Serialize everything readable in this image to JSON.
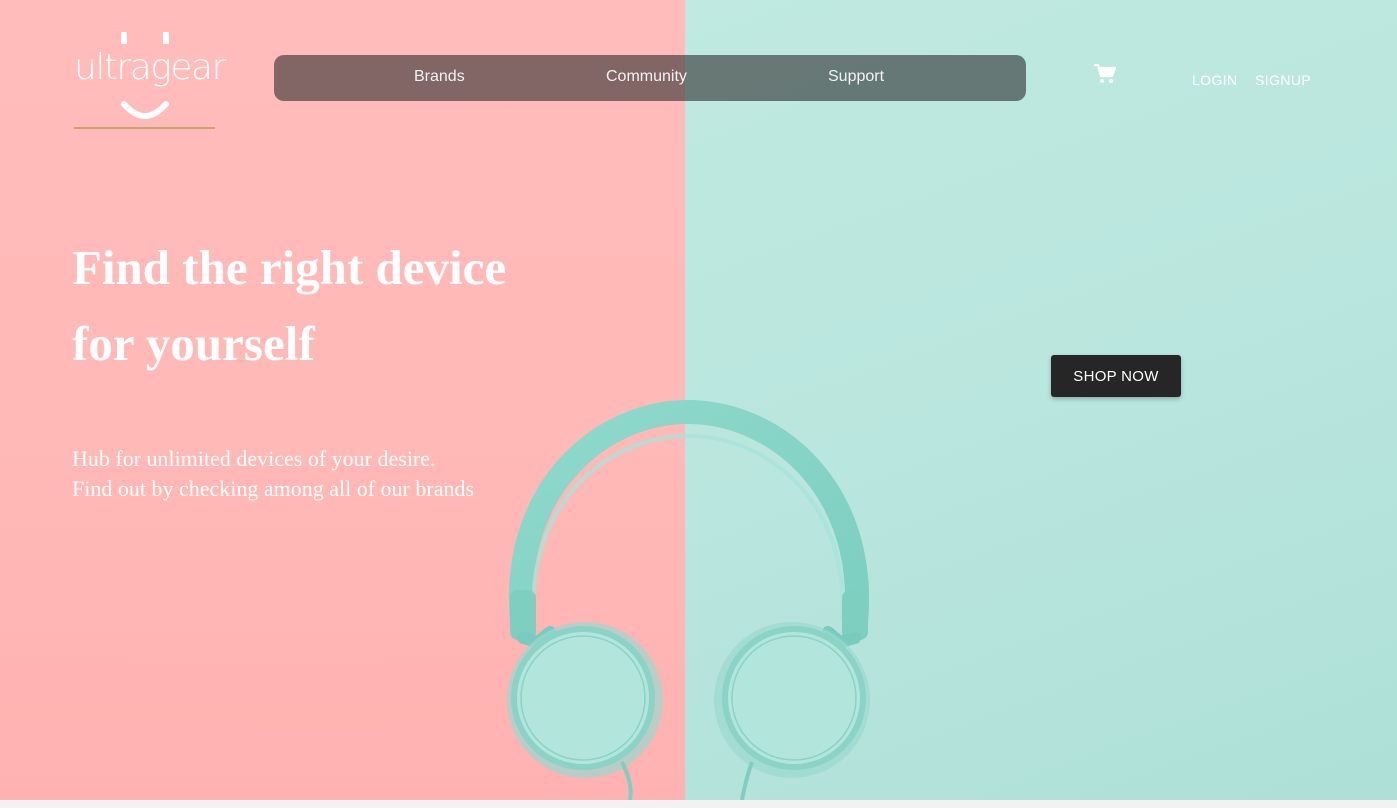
{
  "logo": {
    "text": "ultragear"
  },
  "nav": {
    "links": [
      "Brands",
      "Community",
      "Support"
    ]
  },
  "icons": {
    "cart": "shopping-cart-icon"
  },
  "auth": {
    "login": "LOGIN",
    "signup": "SIGNUP"
  },
  "hero": {
    "headline_line1": "Find the right device",
    "headline_line2": "for yourself",
    "subtext_line1": "Hub for unlimited devices of your desire.",
    "subtext_line2": "Find out by checking among all of our brands",
    "cta": "SHOP NOW"
  },
  "colors": {
    "left_bg": "#ffb9b7",
    "right_bg": "#b9e6de",
    "nav_bg": "rgba(40,40,40,0.58)",
    "button_bg": "#262626",
    "logo_accent": "#c9a26e"
  }
}
